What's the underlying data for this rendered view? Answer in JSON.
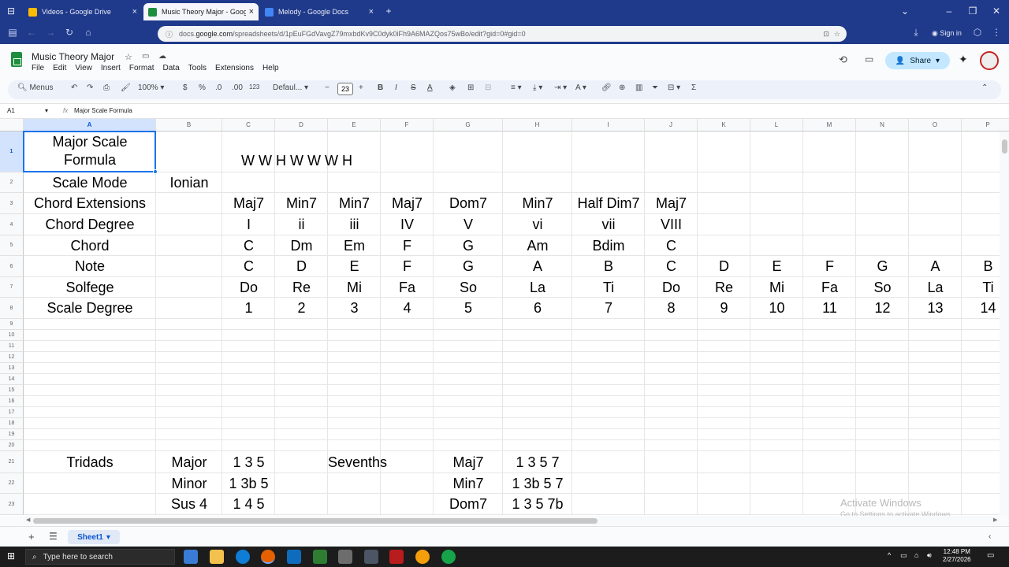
{
  "browser": {
    "tabs": [
      {
        "title": "Videos - Google Drive",
        "active": false
      },
      {
        "title": "Music Theory Major - Google S",
        "active": true
      },
      {
        "title": "Melody - Google Docs",
        "active": false
      }
    ],
    "url_prefix": "docs.",
    "url_host": "google.com",
    "url_path": "/spreadsheets/d/1pEuFGdVavgZ79mxbdKv9C0dyk0iFh9A6MAZQos75wBo/edit?gid=0#gid=0",
    "signin_label": "Sign in"
  },
  "doc": {
    "title": "Music Theory Major",
    "menu": [
      "File",
      "Edit",
      "View",
      "Insert",
      "Format",
      "Data",
      "Tools",
      "Extensions",
      "Help"
    ],
    "share_label": "Share"
  },
  "toolbar": {
    "menus_label": "Menus",
    "zoom": "100%",
    "currency": "$",
    "percent": "%",
    "dec_down": ".0",
    "dec_up": ".00",
    "number_format": "123",
    "font": "Defaul...",
    "font_size": "23"
  },
  "formula_bar": {
    "cell_ref": "A1",
    "fx": "fx",
    "value": "Major Scale Formula"
  },
  "grid": {
    "columns": [
      "A",
      "B",
      "C",
      "D",
      "E",
      "F",
      "G",
      "H",
      "I",
      "J",
      "K",
      "L",
      "M",
      "N",
      "O",
      "P"
    ],
    "rows": [
      "1",
      "2",
      "3",
      "4",
      "5",
      "6",
      "7",
      "8",
      "9",
      "10",
      "11",
      "12",
      "13",
      "14",
      "15",
      "16",
      "17",
      "18",
      "19",
      "20",
      "21",
      "22",
      "23"
    ],
    "selected_cell": "A1",
    "cells": {
      "A1": "Major Scale\nFormula",
      "C1": "W W H W W W H",
      "A2": "Scale Mode",
      "B2": "Ionian",
      "A3": "Chord Extensions",
      "C3": "Maj7",
      "D3": "Min7",
      "E3": "Min7",
      "F3": "Maj7",
      "G3": "Dom7",
      "H3": "Min7",
      "I3": "Half Dim7",
      "J3": "Maj7",
      "A4": "Chord Degree",
      "C4": "I",
      "D4": "ii",
      "E4": "iii",
      "F4": "IV",
      "G4": "V",
      "H4": "vi",
      "I4": "vii",
      "J4": "VIII",
      "A5": "Chord",
      "C5": "C",
      "D5": "Dm",
      "E5": "Em",
      "F5": "F",
      "G5": "G",
      "H5": "Am",
      "I5": "Bdim",
      "J5": "C",
      "A6": "Note",
      "C6": "C",
      "D6": "D",
      "E6": "E",
      "F6": "F",
      "G6": "G",
      "H6": "A",
      "I6": "B",
      "J6": "C",
      "K6": "D",
      "L6": "E",
      "M6": "F",
      "N6": "G",
      "O6": "A",
      "P6": "B",
      "A7": "Solfege",
      "C7": "Do",
      "D7": "Re",
      "E7": "Mi",
      "F7": "Fa",
      "G7": "So",
      "H7": "La",
      "I7": "Ti",
      "J7": "Do",
      "K7": "Re",
      "L7": "Mi",
      "M7": "Fa",
      "N7": "So",
      "O7": "La",
      "P7": "Ti",
      "A8": "Scale Degree",
      "C8": "1",
      "D8": "2",
      "E8": "3",
      "F8": "4",
      "G8": "5",
      "H8": "6",
      "I8": "7",
      "J8": "8",
      "K8": "9",
      "L8": "10",
      "M8": "11",
      "N8": "12",
      "O8": "13",
      "P8": "14",
      "A21": "Tridads",
      "B21": "Major",
      "C21": "1 3 5",
      "E21": "Sevenths",
      "G21": "Maj7",
      "H21": "1 3 5 7",
      "B22": "Minor",
      "C22": "1 3b 5",
      "G22": "Min7",
      "H22": "1 3b 5 7",
      "B23": "Sus 4",
      "C23": "1 4 5",
      "G23": "Dom7",
      "H23": "1 3 5 7b"
    }
  },
  "watermark": {
    "line1": "Activate Windows",
    "line2": "Go to Settings to activate Windows."
  },
  "sheets": [
    {
      "name": "Sheet1",
      "active": true
    }
  ],
  "taskbar": {
    "search_placeholder": "Type here to search",
    "time": "12:48 PM",
    "date": "2/27/2026"
  },
  "colors": {
    "browser_chrome": "#1f3a8a",
    "selection": "#1a73e8",
    "sheets_green": "#1e8e3e",
    "share_bg": "#c2e7ff"
  }
}
